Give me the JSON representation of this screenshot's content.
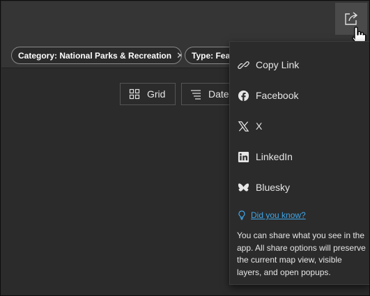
{
  "filters": {
    "chips": [
      {
        "label": "Category: National Parks & Recreation",
        "close": "✕"
      },
      {
        "label": "Type: Feat"
      }
    ]
  },
  "view_buttons": {
    "grid_label": "Grid",
    "date_label": "Date"
  },
  "share_menu": {
    "items": [
      {
        "label": "Copy Link",
        "icon": "link-icon"
      },
      {
        "label": "Facebook",
        "icon": "facebook-icon"
      },
      {
        "label": "X",
        "icon": "x-icon"
      },
      {
        "label": "LinkedIn",
        "icon": "linkedin-icon"
      },
      {
        "label": "Bluesky",
        "icon": "bluesky-icon"
      }
    ],
    "tip_link": "Did you know?",
    "tip_text": "You can share what you see in the app. All share options will preserve the current map view, visible layers, and open popups."
  },
  "colors": {
    "accent_link": "#3fa6e8",
    "panel_bg": "#2b2b2b",
    "topbar_bg": "#353535"
  }
}
